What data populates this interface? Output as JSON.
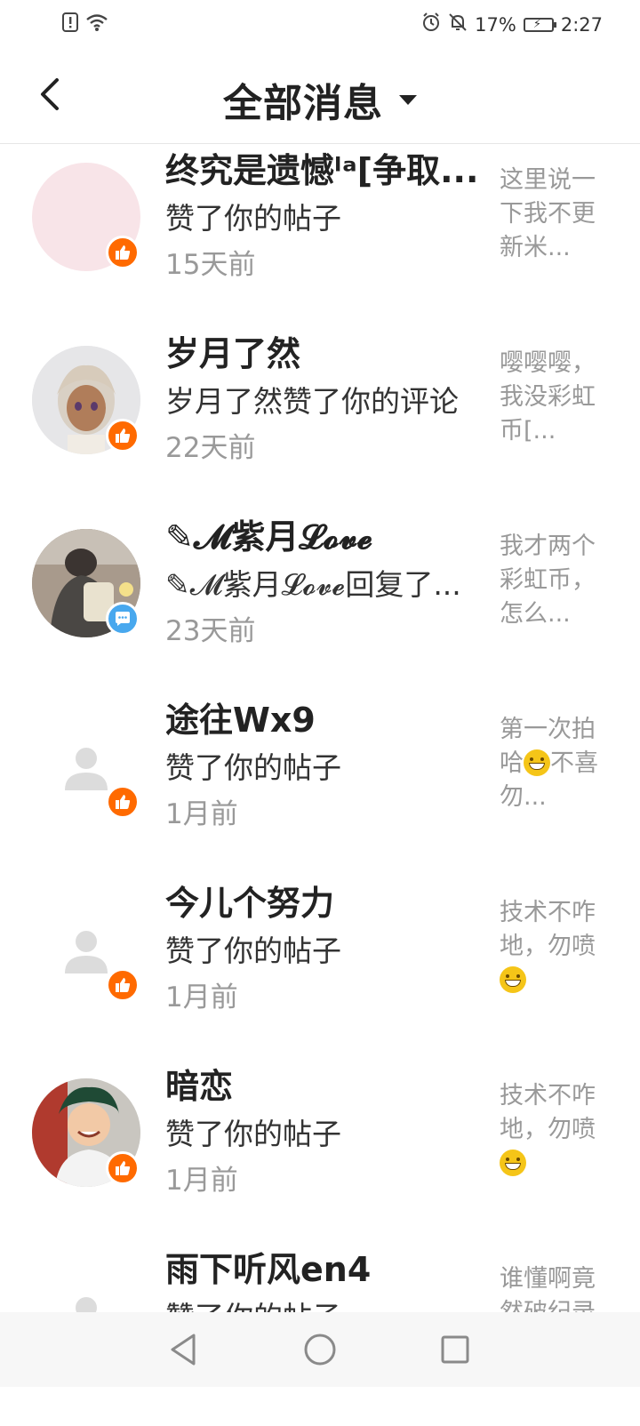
{
  "status_bar": {
    "battery": "17%",
    "time": "2:27",
    "icons": [
      "sim-alert-icon",
      "wifi-icon",
      "alarm-icon",
      "mute-icon",
      "battery-icon"
    ]
  },
  "header": {
    "title": "全部消息",
    "back_icon": "chevron-left-icon",
    "dropdown_icon": "caret-down-icon"
  },
  "messages": [
    {
      "name": "终究是遗憾ˡᵃ[争取...",
      "action": "赞了你的帖子",
      "time": "15天前",
      "preview": "这里说一下我不更新米...",
      "badge": "like",
      "avatar": "pink"
    },
    {
      "name": "岁月了然",
      "action": "岁月了然赞了你的评论",
      "time": "22天前",
      "preview": "嘤嘤嘤，我没彩虹币[...",
      "badge": "like",
      "avatar": "anime-girl"
    },
    {
      "name": "✎𝓜紫月𝓛𝓸𝓿𝓮",
      "action": "✎𝓜紫月𝓛𝓸𝓿𝓮回复了...",
      "time": "23天前",
      "preview": "我才两个彩虹币，怎么...",
      "badge": "comment",
      "avatar": "photo"
    },
    {
      "name": "途往Wx9",
      "action": "赞了你的帖子",
      "time": "1月前",
      "preview_pre": "第一次拍哈",
      "preview_post": "不喜勿...",
      "badge": "like",
      "avatar": "default"
    },
    {
      "name": "今儿个努力",
      "action": "赞了你的帖子",
      "time": "1月前",
      "preview_pre": "技术不咋地，勿喷",
      "preview_post": "",
      "badge": "like",
      "avatar": "default"
    },
    {
      "name": "暗恋",
      "action": "赞了你的帖子",
      "time": "1月前",
      "preview_pre": "技术不咋地，勿喷",
      "preview_post": "",
      "badge": "like",
      "avatar": "anime-boy"
    },
    {
      "name": "雨下听风en4",
      "action": "赞了你的帖子",
      "time": "",
      "preview": "谁懂啊竟然破纪录",
      "badge": "like",
      "avatar": "default"
    }
  ],
  "colors": {
    "like_badge": "#ff6a00",
    "comment_badge": "#48a8ee",
    "muted_text": "#999999"
  }
}
